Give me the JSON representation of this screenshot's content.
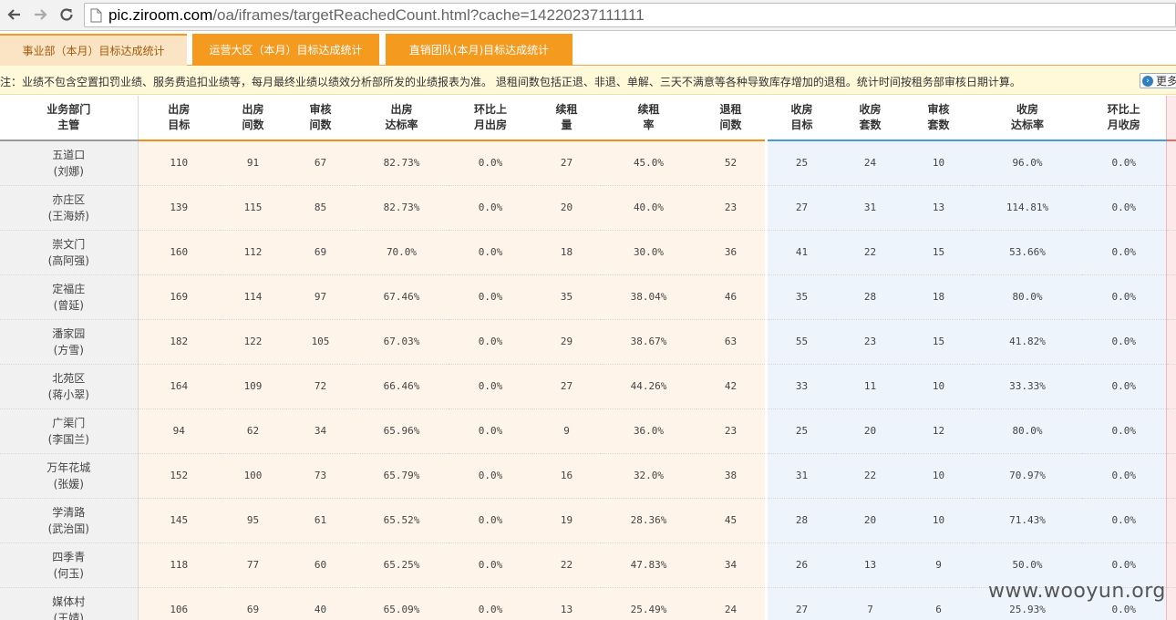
{
  "browser": {
    "url_host": "pic.ziroom.com",
    "url_rest": "/oa/iframes/targetReachedCount.html?cache=14220237111111"
  },
  "tabs": [
    {
      "label": "事业部（本月）目标达成统计"
    },
    {
      "label": "运营大区（本月）目标达成统计"
    },
    {
      "label": "直销团队(本月)目标达成统计"
    }
  ],
  "notice": {
    "text": "注：业绩不包含空置扣罚业绩、服务费追扣业绩等，每月最终业绩以绩效分析部所发的业绩报表为准。  退租间数包括正退、非退、单解、三天不满意等各种导致库存增加的退租。统计时间按租务部审核日期计算。",
    "more_label": "更多"
  },
  "table": {
    "headers": {
      "dept_1": "业务部门",
      "dept_2": "主管",
      "h1_1": "出房",
      "h1_2": "目标",
      "h2_1": "出房",
      "h2_2": "间数",
      "h3_1": "审核",
      "h3_2": "间数",
      "h4_1": "出房",
      "h4_2": "达标率",
      "h5_1": "环比上",
      "h5_2": "月出房",
      "h6_1": "续租",
      "h6_2": "量",
      "h7_1": "续租",
      "h7_2": "率",
      "h8_1": "退租",
      "h8_2": "间数",
      "h9_1": "收房",
      "h9_2": "目标",
      "h10_1": "收房",
      "h10_2": "套数",
      "h11_1": "审核",
      "h11_2": "套数",
      "h12_1": "收房",
      "h12_2": "达标率",
      "h13_1": "环比上",
      "h13_2": "月收房"
    },
    "rows": [
      {
        "dept": "五道口",
        "mgr": "(刘娜)",
        "c": [
          "110",
          "91",
          "67",
          "82.73%",
          "0.0%",
          "27",
          "45.0%",
          "52",
          "25",
          "24",
          "10",
          "96.0%",
          "0.0%"
        ]
      },
      {
        "dept": "亦庄区",
        "mgr": "(王海娇)",
        "c": [
          "139",
          "115",
          "85",
          "82.73%",
          "0.0%",
          "20",
          "40.0%",
          "23",
          "27",
          "31",
          "13",
          "114.81%",
          "0.0%"
        ]
      },
      {
        "dept": "崇文门",
        "mgr": "(高阿强)",
        "c": [
          "160",
          "112",
          "69",
          "70.0%",
          "0.0%",
          "18",
          "30.0%",
          "36",
          "41",
          "22",
          "15",
          "53.66%",
          "0.0%"
        ]
      },
      {
        "dept": "定福庄",
        "mgr": "(曾延)",
        "c": [
          "169",
          "114",
          "97",
          "67.46%",
          "0.0%",
          "35",
          "38.04%",
          "46",
          "35",
          "28",
          "18",
          "80.0%",
          "0.0%"
        ]
      },
      {
        "dept": "潘家园",
        "mgr": "(方雪)",
        "c": [
          "182",
          "122",
          "105",
          "67.03%",
          "0.0%",
          "29",
          "38.67%",
          "63",
          "55",
          "23",
          "15",
          "41.82%",
          "0.0%"
        ]
      },
      {
        "dept": "北苑区",
        "mgr": "(蒋小翠)",
        "c": [
          "164",
          "109",
          "72",
          "66.46%",
          "0.0%",
          "27",
          "44.26%",
          "42",
          "33",
          "11",
          "10",
          "33.33%",
          "0.0%"
        ]
      },
      {
        "dept": "广渠门",
        "mgr": "(李国兰)",
        "c": [
          "94",
          "62",
          "34",
          "65.96%",
          "0.0%",
          "9",
          "36.0%",
          "23",
          "25",
          "20",
          "12",
          "80.0%",
          "0.0%"
        ]
      },
      {
        "dept": "万年花城",
        "mgr": "(张媛)",
        "c": [
          "152",
          "100",
          "73",
          "65.79%",
          "0.0%",
          "16",
          "32.0%",
          "38",
          "31",
          "22",
          "10",
          "70.97%",
          "0.0%"
        ]
      },
      {
        "dept": "学清路",
        "mgr": "(武治国)",
        "c": [
          "145",
          "95",
          "61",
          "65.52%",
          "0.0%",
          "19",
          "28.36%",
          "45",
          "28",
          "20",
          "10",
          "71.43%",
          "0.0%"
        ]
      },
      {
        "dept": "四季青",
        "mgr": "(何玉)",
        "c": [
          "118",
          "77",
          "60",
          "65.25%",
          "0.0%",
          "22",
          "47.83%",
          "34",
          "26",
          "13",
          "9",
          "50.0%",
          "0.0%"
        ]
      },
      {
        "dept": "媒体村",
        "mgr": "(王婧)",
        "c": [
          "106",
          "69",
          "40",
          "65.09%",
          "0.0%",
          "13",
          "25.49%",
          "24",
          "27",
          "7",
          "6",
          "25.93%",
          "0.0%"
        ]
      }
    ]
  },
  "watermark": "www.wooyun.org"
}
